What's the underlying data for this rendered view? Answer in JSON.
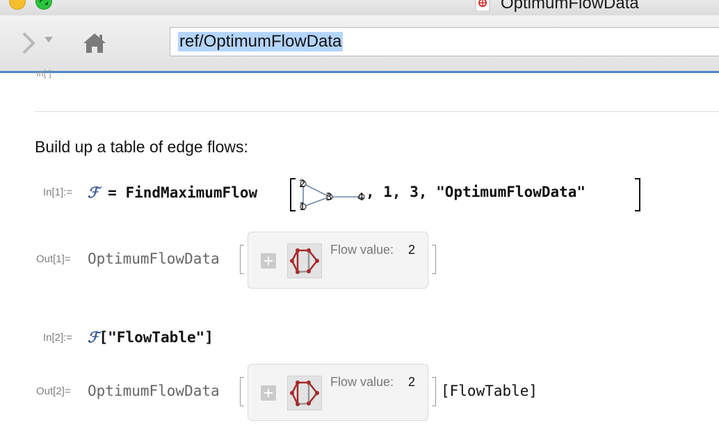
{
  "window": {
    "title": "OptimumFlowData"
  },
  "toolbar": {
    "address": "ref/OptimumFlowData"
  },
  "cells": {
    "partial_label": "In[ ]",
    "intro": "Build up a table of edge flows:",
    "in1": {
      "label": "In[1]:=",
      "symbol": "ℱ",
      "assign": "=",
      "func": "FindMaximumFlow",
      "graph_vertices": [
        "1",
        "2",
        "3",
        "4"
      ],
      "args": ", 1, 3, \"OptimumFlowData\""
    },
    "out1": {
      "label": "Out[1]=",
      "head": "OptimumFlowData",
      "flow_label": "Flow value:",
      "flow_value": "2"
    },
    "in2": {
      "label": "In[2]:=",
      "symbol": "ℱ",
      "arg": "[\"FlowTable\"]"
    },
    "out2": {
      "label": "Out[2]=",
      "head": "OptimumFlowData",
      "flow_label": "Flow value:",
      "flow_value": "2",
      "suffix": "[FlowTable]"
    }
  },
  "icons": [
    "minimize-button",
    "zoom-button",
    "document-icon",
    "forward-arrow-icon",
    "chevron-down-icon",
    "home-icon",
    "plus-icon",
    "flow-graph-thumbnail"
  ],
  "colors": {
    "accent_bar": "#4a86c8",
    "selection": "#b5d5fd",
    "flow_edge": "#a52a2a",
    "graph_edge": "#6e87a8"
  }
}
